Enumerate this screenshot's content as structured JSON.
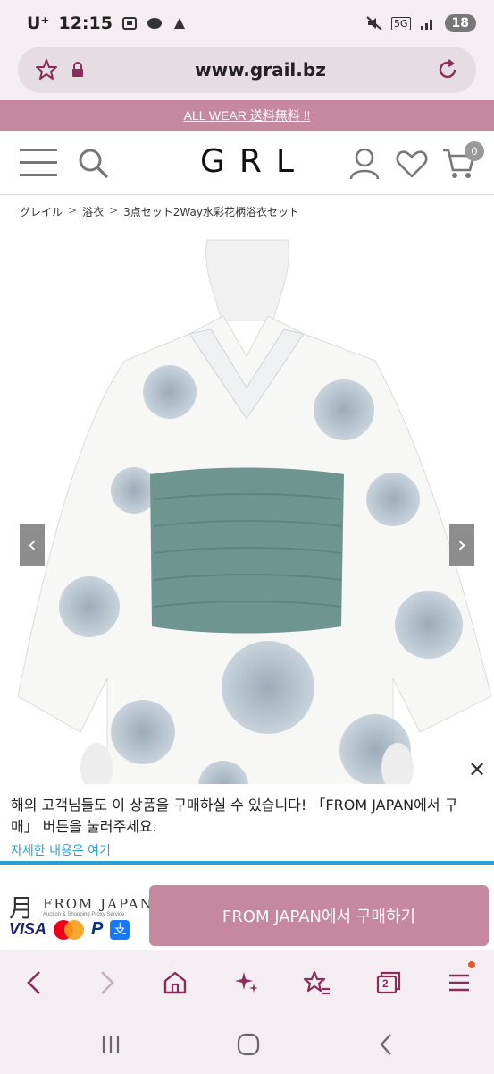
{
  "status_bar": {
    "carrier": "U⁺",
    "time": "12:15",
    "network": "5G",
    "battery": "18"
  },
  "browser": {
    "url": "www.grail.bz"
  },
  "promo": {
    "text": "ALL WEAR 送料無料 !!"
  },
  "header": {
    "logo": "GRL",
    "cart_count": "0"
  },
  "breadcrumb": {
    "items": [
      "グレイル",
      "浴衣",
      "3点セット2Way水彩花柄浴衣セット"
    ],
    "separator": ">"
  },
  "product": {
    "prev_label": "‹",
    "next_label": "›"
  },
  "notice": {
    "text": "해외 고객님들도 이 상품을 구매하실 수 있습니다! 「FROM JAPAN에서 구매」 버튼을 눌러주세요.",
    "link": "자세한 내용은 여기",
    "close": "✕"
  },
  "from_japan": {
    "brand": "FROM JAPAN",
    "tagline": "Auction & Shopping Proxy Service",
    "visa": "VISA",
    "paypal": "P",
    "alipay": "支",
    "button_label": "FROM JAPAN에서 구매하기"
  },
  "toolbar": {
    "tab_count": "2"
  },
  "colors": {
    "accent": "#c5889f",
    "browser_bg": "#f4eef2",
    "link": "#2a9fd6",
    "icon": "#8a2d5a"
  }
}
